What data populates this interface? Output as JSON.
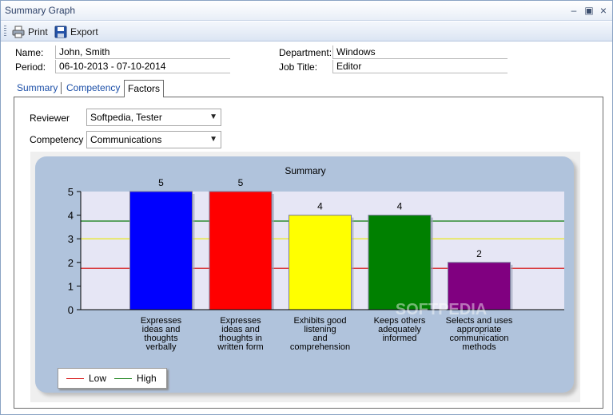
{
  "window": {
    "title": "Summary Graph"
  },
  "toolbar": {
    "print_label": "Print",
    "export_label": "Export"
  },
  "info": {
    "name_label": "Name:",
    "name_value": "John, Smith",
    "period_label": "Period:",
    "period_value": "06-10-2013 - 07-10-2014",
    "department_label": "Department:",
    "department_value": "Windows",
    "jobtitle_label": "Job Title:",
    "jobtitle_value": "Editor"
  },
  "tabs": [
    {
      "label": "Summary",
      "active": false
    },
    {
      "label": "Competency",
      "active": false
    },
    {
      "label": "Factors",
      "active": true
    }
  ],
  "filters": {
    "reviewer_label": "Reviewer",
    "reviewer_value": "Softpedia, Tester",
    "competency_label": "Competency",
    "competency_value": "Communications"
  },
  "watermark": "SOFTPEDIA",
  "chart_data": {
    "type": "bar",
    "title": "Summary",
    "ylim": [
      0,
      5
    ],
    "yticks": [
      "0",
      "1",
      "2",
      "3",
      "4",
      "5"
    ],
    "categories": [
      [
        "Expresses",
        "ideas and",
        "thoughts",
        "verbally"
      ],
      [
        "Expresses",
        "ideas and",
        "thoughts in",
        "written form"
      ],
      [
        "Exhibits good",
        "listening",
        "and",
        "comprehension"
      ],
      [
        "Keeps others",
        "adequately",
        "informed"
      ],
      [
        "Selects and uses",
        "appropriate",
        "communication",
        "methods"
      ]
    ],
    "values": [
      5,
      5,
      4,
      4,
      2
    ],
    "colors": [
      "#0000ff",
      "#ff0000",
      "#ffff00",
      "#008000",
      "#800080"
    ],
    "reference_lines": [
      {
        "name": "Low",
        "value": 1.75,
        "color": "#d40000"
      },
      {
        "name": "",
        "value": 3,
        "color": "#e8e800"
      },
      {
        "name": "High",
        "value": 3.75,
        "color": "#0a7a0a"
      }
    ],
    "legend": [
      "Low",
      "High"
    ],
    "legend_position": "bottom-left"
  }
}
